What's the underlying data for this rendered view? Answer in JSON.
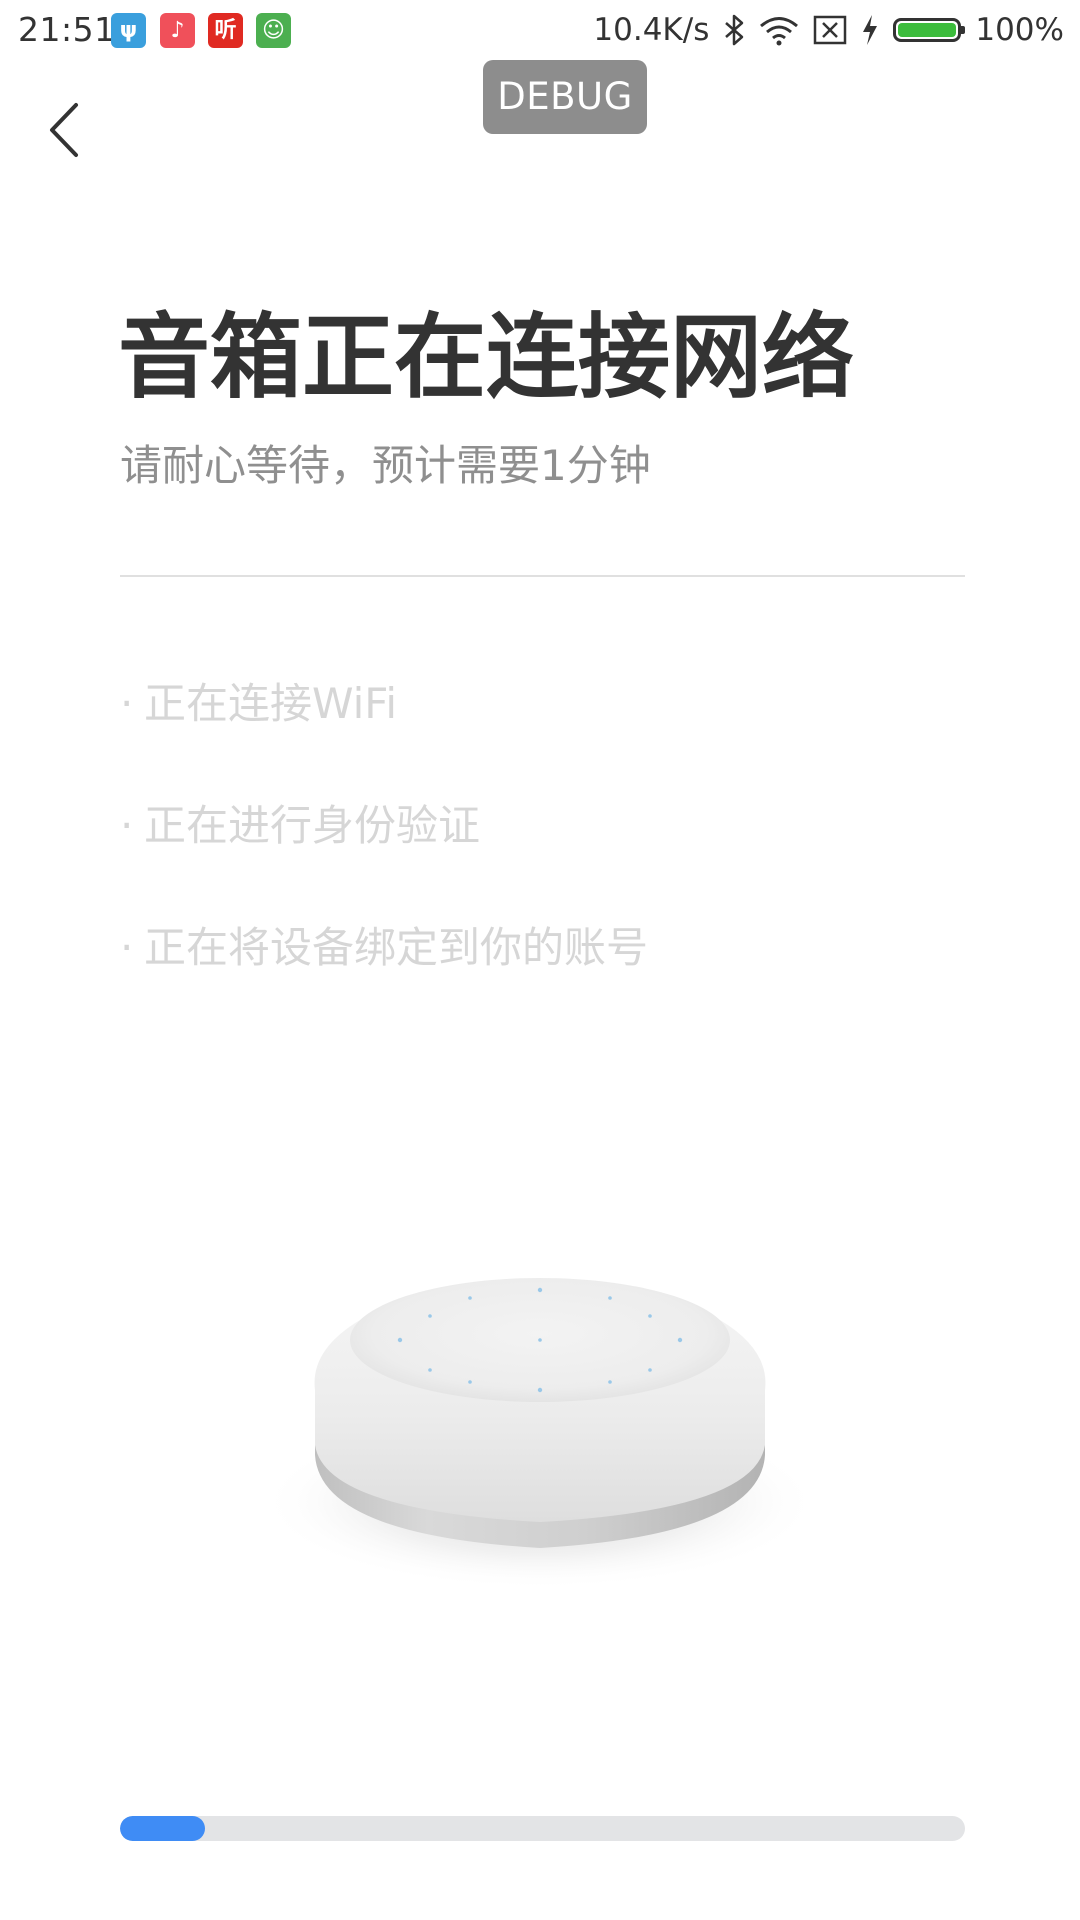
{
  "status_bar": {
    "time": "21:51",
    "network_speed": "10.4K/s",
    "battery_percent": "100%",
    "battery_level": 1.0,
    "icons": [
      "usb-icon",
      "music-app-icon",
      "listen-app-icon",
      "android-app-icon",
      "bluetooth-icon",
      "wifi-icon",
      "sim-no-service-icon",
      "charging-icon",
      "battery-icon"
    ],
    "app_icon_colors": {
      "usb": "#3a9fdd",
      "music": "#f0505a",
      "listen": "#e02a22",
      "android": "#4caf50"
    },
    "app_icon_glyphs": {
      "usb": "ψ",
      "music": "♪",
      "listen": "听",
      "android": "☺"
    }
  },
  "debug_label": "DEBUG",
  "header": {
    "title": "音箱正在连接网络",
    "subtitle": "请耐心等待，预计需要1分钟"
  },
  "steps": [
    {
      "dot": "·",
      "label": "正在连接WiFi"
    },
    {
      "dot": "·",
      "label": "正在进行身份验证"
    },
    {
      "dot": "·",
      "label": "正在将设备绑定到你的账号"
    }
  ],
  "progress": {
    "value": 0.1,
    "color": "#3f8cf5",
    "track_color": "#e3e4e6"
  }
}
